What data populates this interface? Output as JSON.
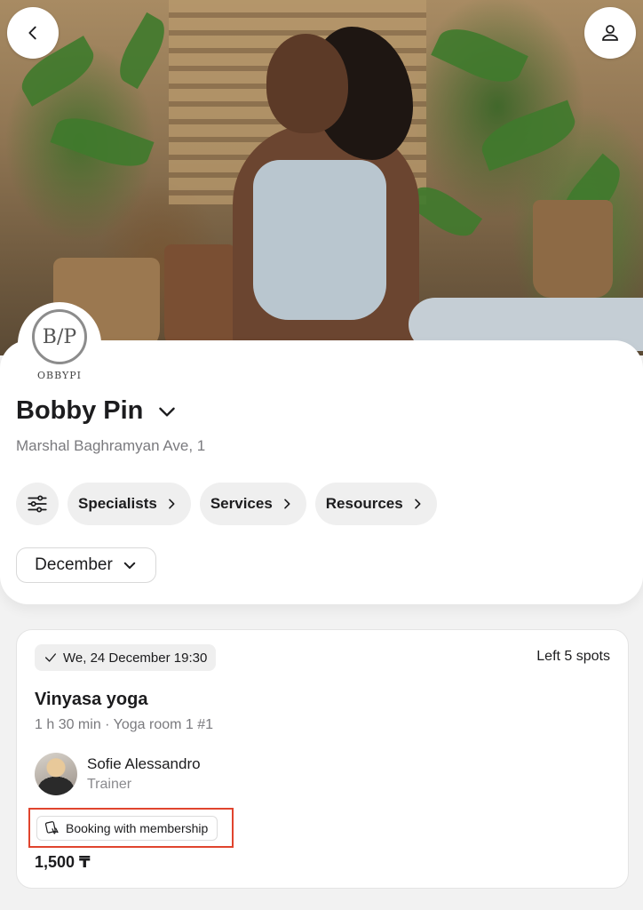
{
  "header": {
    "back_icon": "chevron-left-icon",
    "profile_icon": "user-icon"
  },
  "venue": {
    "logo_text": "B/P",
    "logo_wordmark": "OBBYPI",
    "name": "Bobby Pin",
    "address": "Marshal Baghramyan Ave, 1"
  },
  "filters": {
    "filter_icon": "sliders-icon",
    "chips": [
      "Specialists",
      "Services",
      "Resources"
    ],
    "month": "December"
  },
  "session": {
    "date": "We, 24 December 19:30",
    "spots": "Left 5 spots",
    "name": "Vinyasa yoga",
    "meta": "1 h 30 min · Yoga room 1 #1",
    "trainer_name": "Sofie Alessandro",
    "trainer_role": "Trainer",
    "membership_label": "Booking with membership",
    "price": "1,500 ₸"
  },
  "colors": {
    "highlight": "#e0442e",
    "chip_bg": "#efefef"
  }
}
